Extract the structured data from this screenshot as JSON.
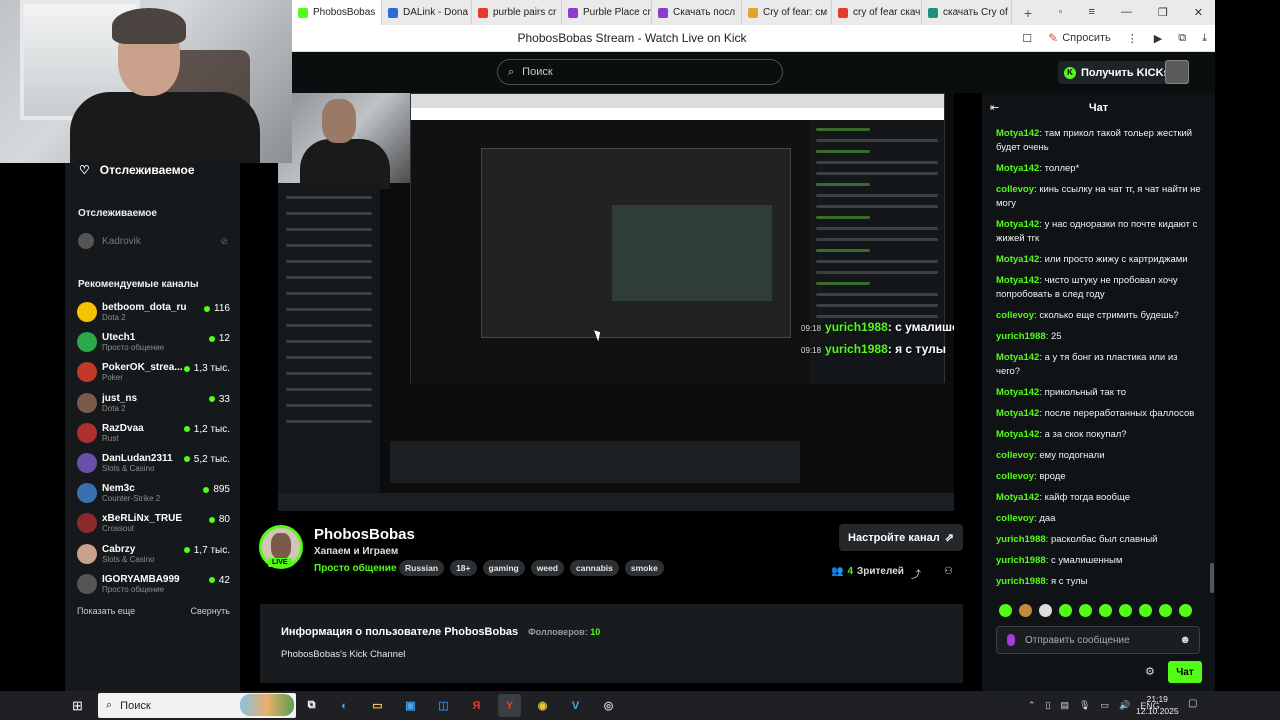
{
  "browser": {
    "tabs": [
      {
        "label": "PhobosBobas",
        "color": "#53fc18",
        "active": true
      },
      {
        "label": "DALink - Dona",
        "color": "#2f6bd8"
      },
      {
        "label": "purble pairs cr",
        "color": "#e53b2b"
      },
      {
        "label": "Purble Place cr",
        "color": "#8c3bd1"
      },
      {
        "label": "Скачать посл",
        "color": "#8c3bd1"
      },
      {
        "label": "Cry of fear: cм",
        "color": "#e0a52b"
      },
      {
        "label": "cry of fear скач",
        "color": "#e53b2b"
      },
      {
        "label": "скачать Cry of",
        "color": "#1d8f7a"
      }
    ],
    "page_title": "PhobosBobas Stream - Watch Live on Kick",
    "ask_label": "Спросить"
  },
  "header": {
    "search_placeholder": "Поиск",
    "get_kicks": "Получить KICKs"
  },
  "sidebar": {
    "following_title": "Отслеживаемое",
    "following_heading": "Отслеживаемое",
    "followed_channel": "Kadrovik",
    "recommended_heading": "Рекомендуемые каналы",
    "channels": [
      {
        "name": "betboom_dota_ru",
        "category": "Dota 2",
        "viewers": "116",
        "color": "#f5c400"
      },
      {
        "name": "Utech1",
        "category": "Просто общение",
        "viewers": "12",
        "color": "#2aa84a"
      },
      {
        "name": "PokerOK_strea...",
        "category": "Poker",
        "viewers": "1,3 тыс.",
        "color": "#c0392b"
      },
      {
        "name": "just_ns",
        "category": "Dota 2",
        "viewers": "33",
        "color": "#7a5a48"
      },
      {
        "name": "RazDvaa",
        "category": "Rust",
        "viewers": "1,2 тыс.",
        "color": "#b03030"
      },
      {
        "name": "DanLudan2311",
        "category": "Slots & Casino",
        "viewers": "5,2 тыс.",
        "color": "#6a4ea8"
      },
      {
        "name": "Nem3c",
        "category": "Counter-Strike 2",
        "viewers": "895",
        "color": "#3a6fb0"
      },
      {
        "name": "xBeRLiNx_TRUE",
        "category": "Crossout",
        "viewers": "80",
        "color": "#8a2a2a"
      },
      {
        "name": "Cabrzy",
        "category": "Slots & Casino",
        "viewers": "1,7 тыс.",
        "color": "#c9a08a"
      },
      {
        "name": "IGORYAMBA999",
        "category": "Просто общение",
        "viewers": "42",
        "color": "#555555"
      }
    ],
    "show_more": "Показать еще",
    "collapse": "Свернуть"
  },
  "overlay": [
    {
      "time": "09:18",
      "user": "yurich1988",
      "text": ": с умалишенным"
    },
    {
      "time": "09:18",
      "user": "yurich1988",
      "text": ": я с тулы"
    }
  ],
  "channel": {
    "name": "PhobosBobas",
    "live": "LIVE",
    "subtitle": "Хапаем и Играем",
    "category": "Просто общение",
    "tags": [
      "Russian",
      "18+",
      "gaming",
      "weed",
      "cannabis",
      "smoke"
    ],
    "setup_button": "Настройте канал",
    "viewers_count": "4",
    "viewers_label": "Зрителей",
    "about_title": "Информация о пользователе PhobosBobas",
    "followers_label": "Фолловеров:",
    "followers_count": "10",
    "description": "PhobosBobas's Kick Channel"
  },
  "chat": {
    "title": "Чат",
    "messages": [
      {
        "user": "Motya142",
        "color": "#53fc18",
        "text": "там прикол такой тольер жесткий будет очень"
      },
      {
        "user": "Motya142",
        "color": "#53fc18",
        "text": "толлер*"
      },
      {
        "user": "collevoy",
        "color": "#53fc18",
        "text": "кинь ссылку на чат тг, я чат найти не могу"
      },
      {
        "user": "Motya142",
        "color": "#53fc18",
        "text": "у нас одноразки по почте кидают с жижей тгк"
      },
      {
        "user": "Motya142",
        "color": "#53fc18",
        "text": "или просто жижу с картриджами"
      },
      {
        "user": "Motya142",
        "color": "#53fc18",
        "text": "чисто штуку не пробовал хочу попробовать в след году"
      },
      {
        "user": "collevoy",
        "color": "#53fc18",
        "text": "сколько еще стримить будешь?"
      },
      {
        "user": "yurich1988",
        "color": "#53fc18",
        "text": "25"
      },
      {
        "user": "Motya142",
        "color": "#53fc18",
        "text": "а у тя бонг из пластика или из чего?"
      },
      {
        "user": "Motya142",
        "color": "#53fc18",
        "text": "прикольный так то"
      },
      {
        "user": "Motya142",
        "color": "#53fc18",
        "text": "после переработанных фаллосов"
      },
      {
        "user": "Motya142",
        "color": "#53fc18",
        "text": "а за скок покупал?"
      },
      {
        "user": "collevoy",
        "color": "#53fc18",
        "text": "ему подогнали"
      },
      {
        "user": "collevoy",
        "color": "#53fc18",
        "text": "вроде"
      },
      {
        "user": "Motya142",
        "color": "#53fc18",
        "text": "кайф тогда вообще"
      },
      {
        "user": "collevoy",
        "color": "#53fc18",
        "text": "даа"
      },
      {
        "user": "yurich1988",
        "color": "#53fc18",
        "text": "расколбас был славный"
      },
      {
        "user": "yurich1988",
        "color": "#53fc18",
        "text": "с умалишенным"
      },
      {
        "user": "yurich1988",
        "color": "#53fc18",
        "text": "я с тулы"
      }
    ],
    "input_placeholder": "Отправить сообщение",
    "send_label": "Чат"
  },
  "taskbar": {
    "search_placeholder": "Поиск",
    "lang": "ENG",
    "time": "21:19",
    "date": "12.10.2025"
  }
}
